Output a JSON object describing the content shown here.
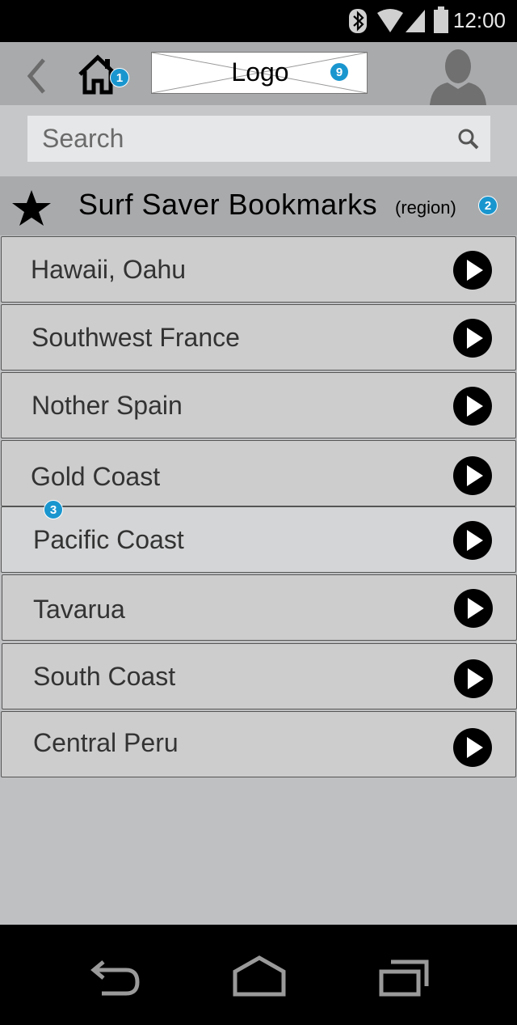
{
  "status_bar": {
    "time": "12:00"
  },
  "app_bar": {
    "logo_text": "Logo",
    "home_badge": "1",
    "logo_badge": "9"
  },
  "search": {
    "placeholder": "Search"
  },
  "list_header": {
    "title": "Surf Saver Bookmarks",
    "subtitle": "(region)",
    "badge": "2"
  },
  "regions": [
    {
      "label": "Hawaii, Oahu"
    },
    {
      "label": "Southwest France"
    },
    {
      "label": "Nother Spain"
    },
    {
      "label": "Gold Coast"
    },
    {
      "label": "Pacific Coast"
    },
    {
      "label": "Tavarua"
    },
    {
      "label": "South Coast"
    },
    {
      "label": "Central Peru"
    }
  ],
  "list_badge": "3",
  "colors": {
    "badge": "#1a96cf",
    "row_bg": "#cdcdcd",
    "app_bar": "#a9aaac"
  }
}
